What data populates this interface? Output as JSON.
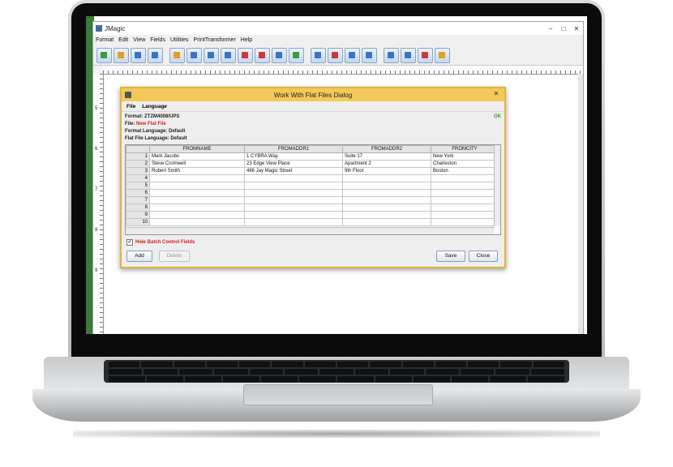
{
  "app": {
    "title": "JMagic",
    "window_buttons": [
      "–",
      "□",
      "✕"
    ]
  },
  "menu": [
    "Format",
    "Edit",
    "View",
    "Fields",
    "Utilities",
    "PrintTransformer",
    "Help"
  ],
  "toolbar": {
    "icons": [
      "new-icon",
      "open-icon",
      "save-icon",
      "print-icon",
      "fields-icon",
      "barcode-icon",
      "text-icon",
      "abc-icon",
      "field-icon",
      "field2-icon",
      "layout-icon",
      "image-icon",
      "import-icon",
      "export-icon",
      "grid-icon",
      "table-icon",
      "find-icon",
      "zoom-icon",
      "back-icon",
      "forward-icon"
    ]
  },
  "ruler": {
    "marks": [
      "5",
      "6",
      "7",
      "8",
      "9"
    ]
  },
  "dialog": {
    "title": "Work With Flat Files Dialog",
    "menu": [
      "File",
      "Language"
    ],
    "format_line": "Format: ZTZM4008/UPS",
    "file_label": "File: ",
    "file_value": "New Flat File",
    "format_language": "Format Language: Default",
    "flat_file_language": "Flat File Language: Default",
    "status": "OK",
    "columns": [
      "FROMNAME",
      "FROMADDR1",
      "FROMADDR2",
      "FROMCITY"
    ],
    "rows": [
      {
        "n": "1",
        "cells": [
          "Mark Jacobs",
          "1 CYBRA Way",
          "Suite 17",
          "New York"
        ]
      },
      {
        "n": "2",
        "cells": [
          "Steve Cromwell",
          "23 Edge View Place",
          "Apartment 2",
          "Charleston"
        ]
      },
      {
        "n": "3",
        "cells": [
          "Robert Smith",
          "486 Jay Magic Street",
          "9th Floor",
          "Boston"
        ]
      },
      {
        "n": "4",
        "cells": [
          "",
          "",
          "",
          ""
        ]
      },
      {
        "n": "5",
        "cells": [
          "",
          "",
          "",
          ""
        ]
      },
      {
        "n": "6",
        "cells": [
          "",
          "",
          "",
          ""
        ]
      },
      {
        "n": "7",
        "cells": [
          "",
          "",
          "",
          ""
        ]
      },
      {
        "n": "8",
        "cells": [
          "",
          "",
          "",
          ""
        ]
      },
      {
        "n": "9",
        "cells": [
          "",
          "",
          "",
          ""
        ]
      },
      {
        "n": "10",
        "cells": [
          "",
          "",
          "",
          ""
        ]
      }
    ],
    "hide_batch_label": "Hide Batch Control Fields",
    "hide_batch_checked": true,
    "buttons": {
      "add": "Add",
      "delete": "Delete",
      "save": "Save",
      "close": "Close"
    }
  }
}
